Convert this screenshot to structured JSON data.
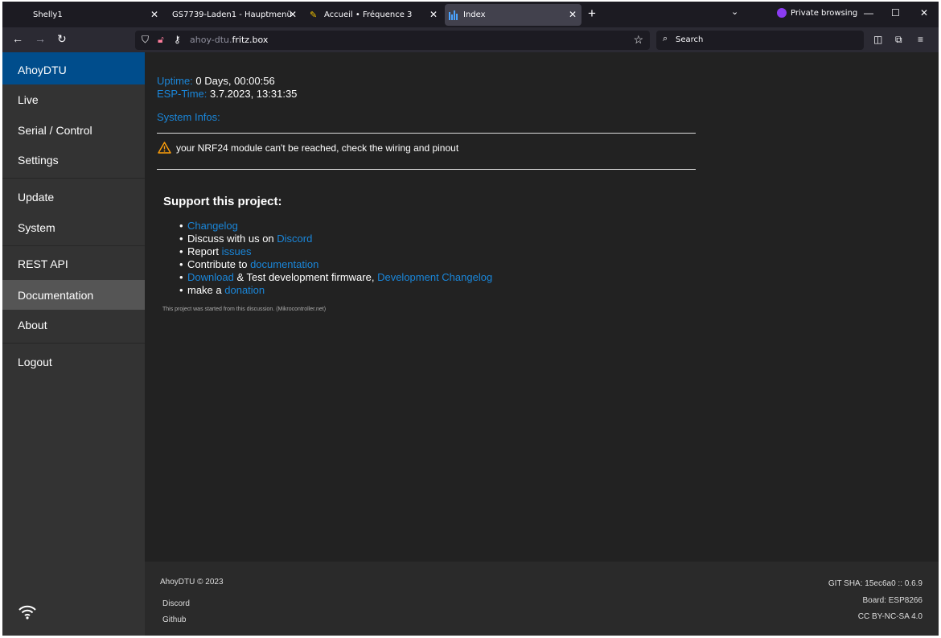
{
  "browser": {
    "tabs": [
      {
        "title": "Shelly1",
        "icon": "none"
      },
      {
        "title": "GS7739-Laden1 - Hauptmenü",
        "icon": "none"
      },
      {
        "title": "Accueil • Fréquence 3",
        "icon": "pencil-logo-icon"
      },
      {
        "title": "Index",
        "icon": "bar-chart-favicon"
      }
    ],
    "private_label": "Private browsing",
    "url_host_prefix": "ahoy-dtu.",
    "url_host_domain": "fritz.box",
    "search_placeholder": "Search",
    "accent_private": "#8b3cf2"
  },
  "sidebar": {
    "brand": "AhoyDTU",
    "items": [
      "Live",
      "Serial / Control",
      "Settings",
      "Update",
      "System",
      "REST API",
      "Documentation",
      "About",
      "Logout"
    ],
    "highlighted": "Documentation",
    "brand_color": "#004d8c"
  },
  "status": {
    "uptime_label": "Uptime:",
    "uptime_value": "0 Days, 00:00:56",
    "esp_time_label": "ESP-Time:",
    "esp_time_value": "3.7.2023, 13:31:35",
    "system_infos_label": "System Infos:",
    "warning": "your NRF24 module can't be reached, check the wiring and pinout",
    "warning_color": "#ff9f0a"
  },
  "support": {
    "heading": "Support this project:",
    "changelog": "Changelog",
    "discuss_prefix": "Discuss with us on",
    "discord": "Discord",
    "report_prefix": "Report",
    "issues": "issues",
    "contribute_prefix": "Contribute to",
    "documentation": "documentation",
    "download": "Download",
    "test_dev": "& Test development firmware,",
    "dev_changelog": "Development Changelog",
    "make_a": "make a",
    "donation": "donation",
    "started_note": "This project was started from this discussion. (Mikrocontroller.net)",
    "link_color": "#1a86d9"
  },
  "footer": {
    "copyright": "AhoyDTU © 2023",
    "link_discord": "Discord",
    "link_github": "Github",
    "git_sha": "GIT SHA: 15ec6a0 :: 0.6.9",
    "board": "Board: ESP8266",
    "license": "CC BY-NC-SA 4.0"
  }
}
